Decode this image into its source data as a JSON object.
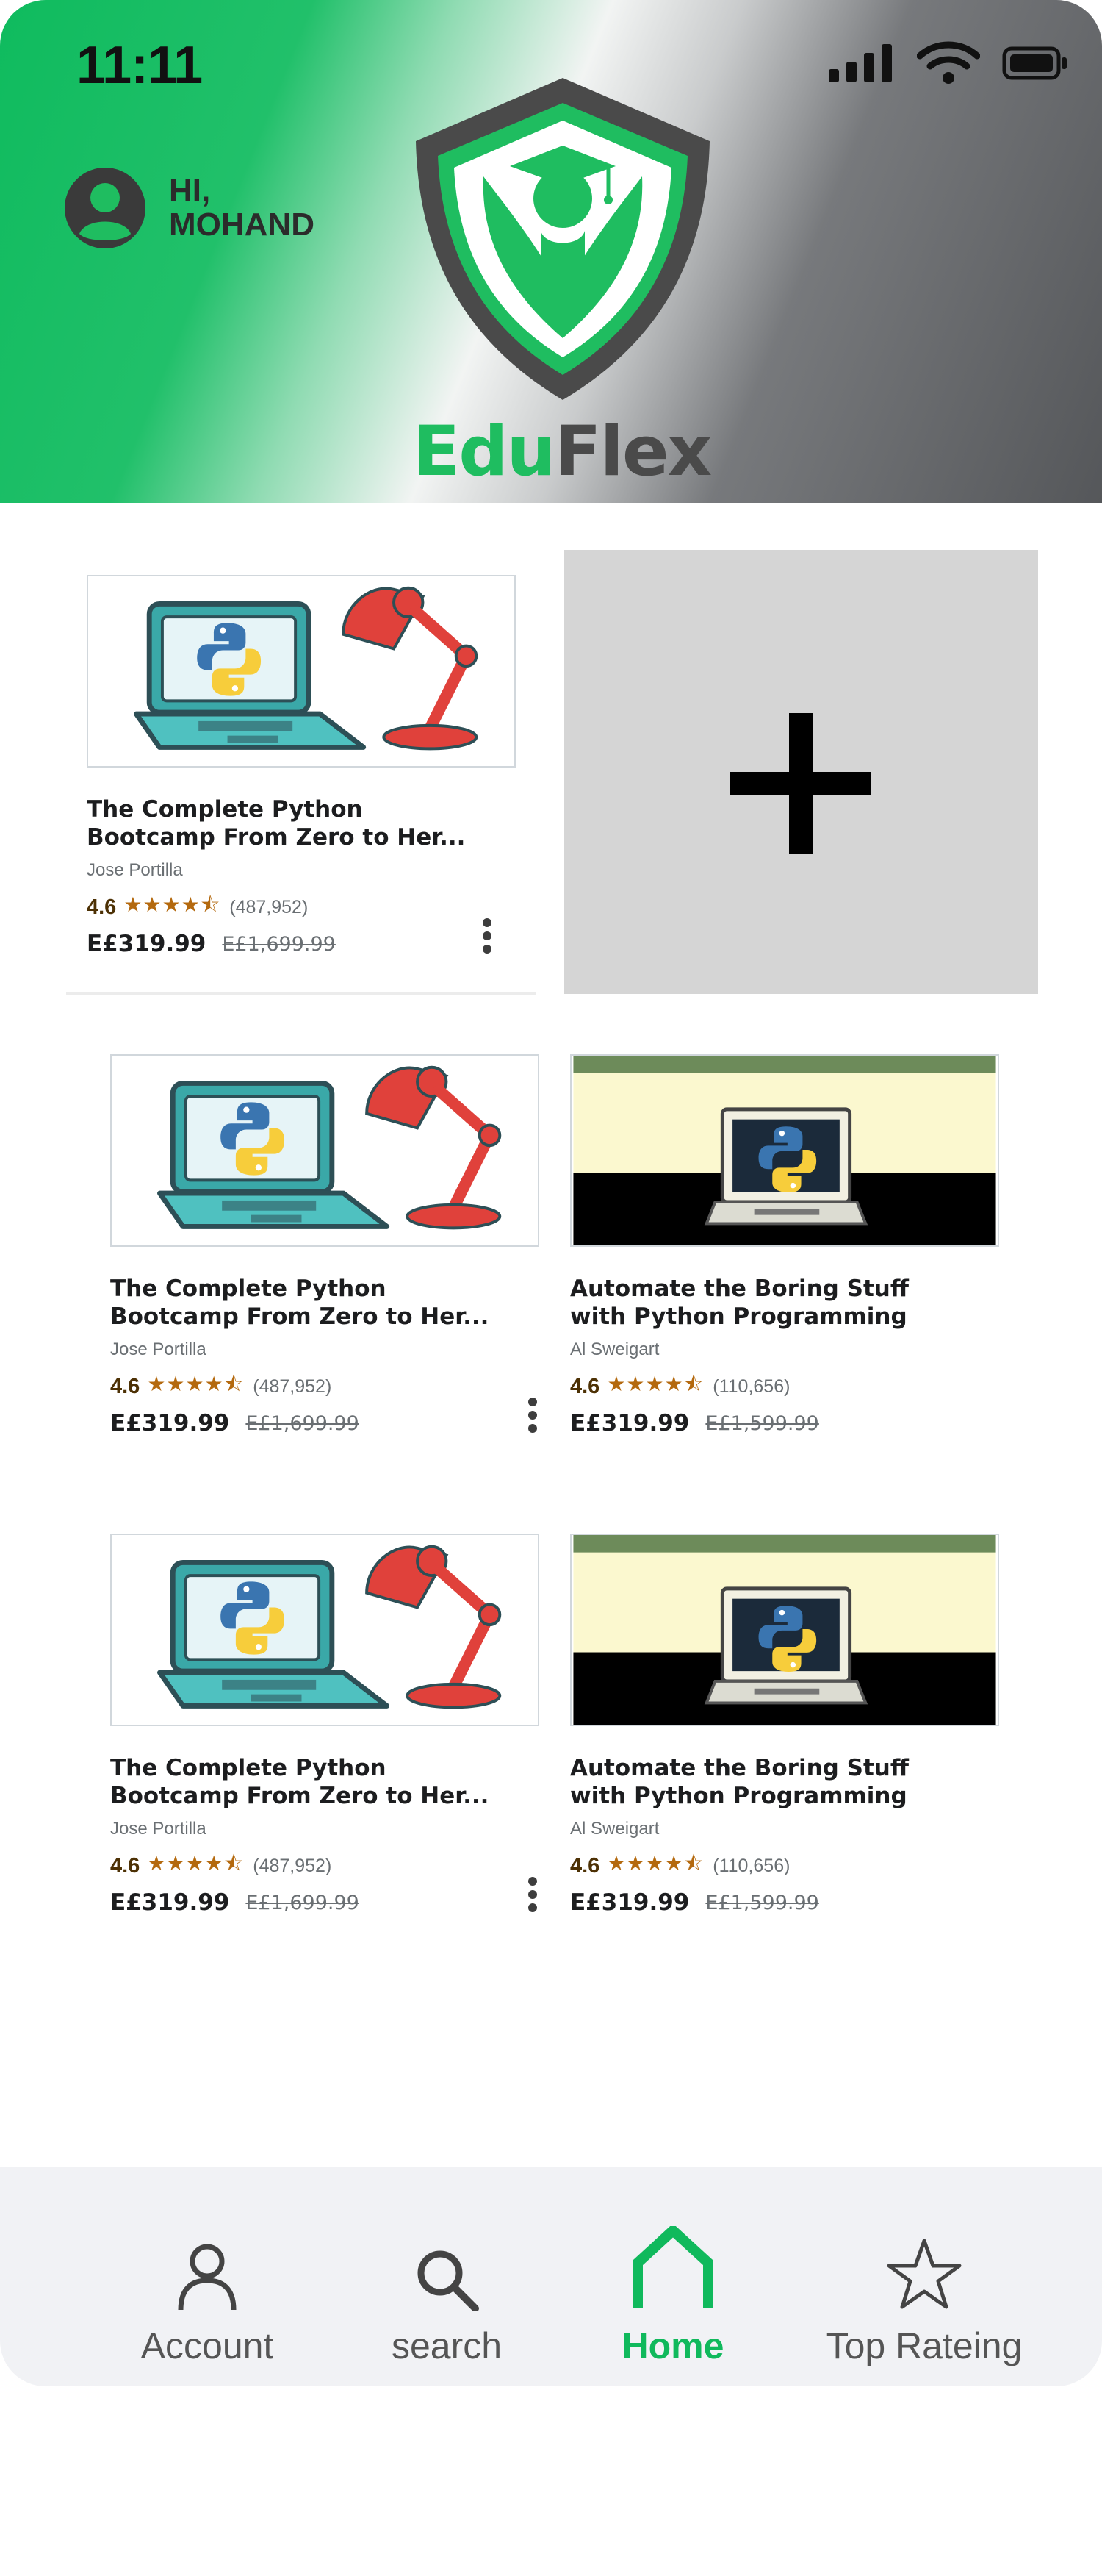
{
  "status_bar": {
    "time": "11:11"
  },
  "header": {
    "greeting": "HI,\nMOHAND",
    "brand_part1": "Edu",
    "brand_part2": "Flex"
  },
  "colors": {
    "accent": "#10b95c",
    "header_dark": "#4a4a4a",
    "star": "#b4690e"
  },
  "courses": [
    {
      "title_line1": "The Complete Python",
      "title_line2": "Bootcamp From Zero to Her...",
      "author": "Jose Portilla",
      "rating": "4.6",
      "stars": "★★★★⯪",
      "reviews": "(487,952)",
      "price": "E£319.99",
      "old_price": "E£1,699.99",
      "thumbnail": "python-laptop-lamp"
    },
    {
      "title_line1": "The Complete Python",
      "title_line2": "Bootcamp From Zero to Her...",
      "author": "Jose Portilla",
      "rating": "4.6",
      "stars": "★★★★⯪",
      "reviews": "(487,952)",
      "price": "E£319.99",
      "old_price": "E£1,699.99",
      "thumbnail": "python-laptop-lamp"
    },
    {
      "title_line1": "Automate the Boring Stuff",
      "title_line2": "with Python Programming",
      "author": "Al Sweigart",
      "rating": "4.6",
      "stars": "★★★★⯪",
      "reviews": "(110,656)",
      "price": "E£319.99",
      "old_price": "E£1,599.99",
      "thumbnail": "python-laptop-black"
    },
    {
      "title_line1": "The Complete Python",
      "title_line2": "Bootcamp From Zero to Her...",
      "author": "Jose Portilla",
      "rating": "4.6",
      "stars": "★★★★⯪",
      "reviews": "(487,952)",
      "price": "E£319.99",
      "old_price": "E£1,699.99",
      "thumbnail": "python-laptop-lamp"
    },
    {
      "title_line1": "Automate the Boring Stuff",
      "title_line2": "with Python Programming",
      "author": "Al Sweigart",
      "rating": "4.6",
      "stars": "★★★★⯪",
      "reviews": "(110,656)",
      "price": "E£319.99",
      "old_price": "E£1,599.99",
      "thumbnail": "python-laptop-black"
    }
  ],
  "add_tile": {
    "icon": "plus-icon"
  },
  "bottom_nav": {
    "items": [
      {
        "label": "Account",
        "icon": "person-icon"
      },
      {
        "label": "search",
        "icon": "search-icon"
      },
      {
        "label": "Home",
        "icon": "home-icon",
        "active": true
      },
      {
        "label": "Top Rateing",
        "icon": "star-icon"
      }
    ]
  }
}
